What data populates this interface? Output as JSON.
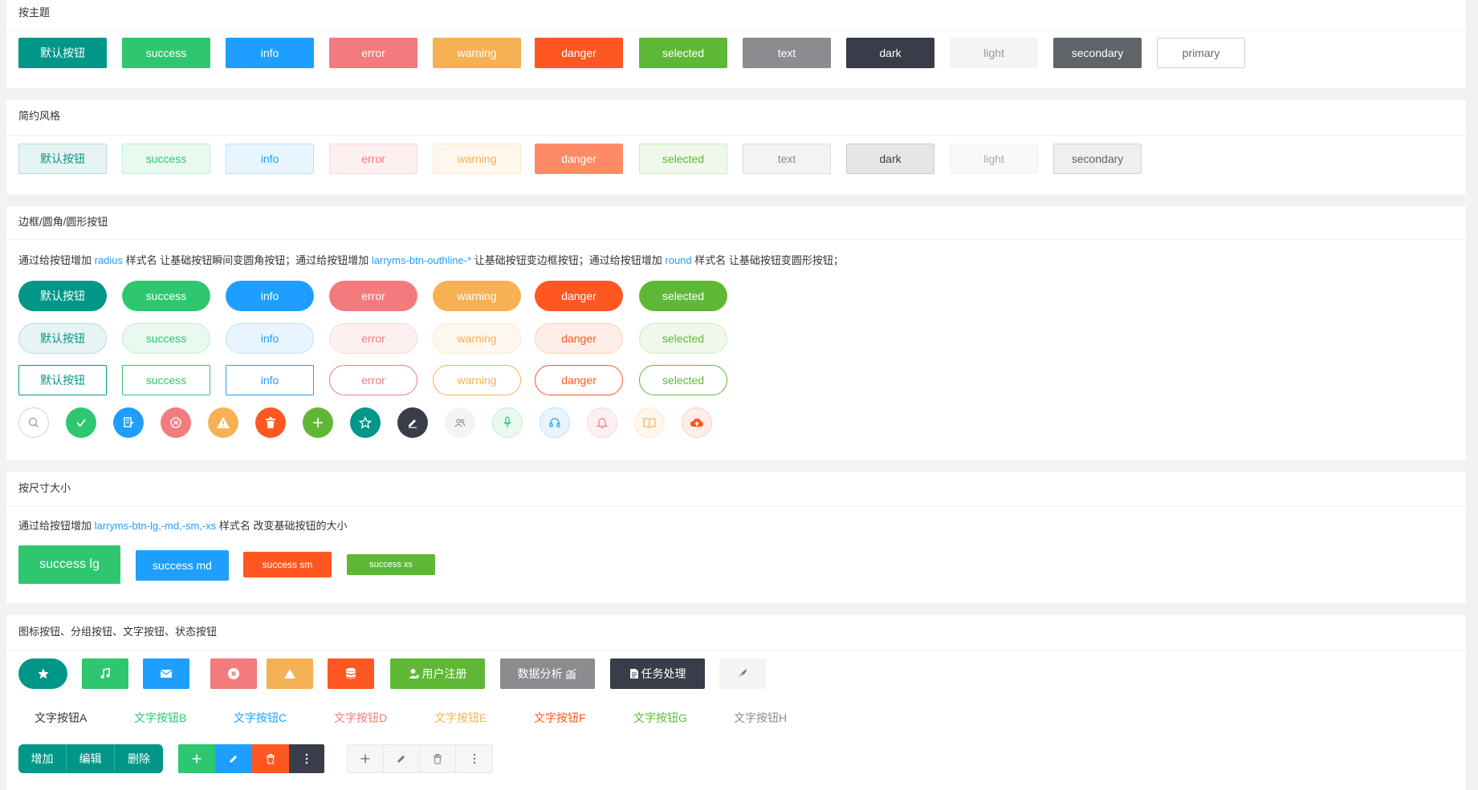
{
  "sections": {
    "theme": {
      "title": "按主题",
      "buttons": [
        "默认按钮",
        "success",
        "info",
        "error",
        "warning",
        "danger",
        "selected",
        "text",
        "dark",
        "light",
        "secondary",
        "primary"
      ]
    },
    "simple": {
      "title": "简约风格",
      "buttons": [
        "默认按钮",
        "success",
        "info",
        "error",
        "warning",
        "danger",
        "selected",
        "text",
        "dark",
        "light",
        "secondary"
      ]
    },
    "border": {
      "title": "边框/圆角/圆形按钮",
      "desc": {
        "p1": "通过给按钮增加 ",
        "k1": "radius",
        "p2": " 样式名 让基础按钮瞬间变圆角按钮；通过给按钮增加 ",
        "k2": "larryms-btn-outhline-*",
        "p3": " 让基础按钮变边框按钮；通过给按钮增加 ",
        "k3": "round",
        "p4": " 样式名 让基础按钮变圆形按钮；"
      },
      "buttons": [
        "默认按钮",
        "success",
        "info",
        "error",
        "warning",
        "danger",
        "selected"
      ]
    },
    "size": {
      "title": "按尺寸大小",
      "desc": {
        "p1": "通过给按钮增加 ",
        "k1": "larryms-btn-lg,-md,-sm,-xs",
        "p2": " 样式名 改变基础按钮的大小"
      },
      "lg": "success lg",
      "md": "success md",
      "sm": "success sm",
      "xs": "success xs"
    },
    "icon": {
      "title": "图标按钮、分组按钮、文字按钮、状态按钮",
      "user_register": "用户注册",
      "data_analysis": "数据分析",
      "task_process": "任务处理",
      "text_buttons": [
        "文字按钮A",
        "文字按钮B",
        "文字按钮C",
        "文字按钮D",
        "文字按钮E",
        "文字按钮F",
        "文字按钮G",
        "文字按钮H"
      ],
      "group": {
        "add": "增加",
        "edit": "编辑",
        "delete": "删除"
      }
    }
  },
  "colors": {
    "default": "#009688",
    "success": "#2ec770",
    "info": "#1e9fff",
    "error": "#f37b7d",
    "warning": "#f7b155",
    "danger": "#ff5722",
    "selected": "#5fb835",
    "text": "#8b8c8f",
    "dark": "#393d49",
    "light": "#f2f4f6",
    "secondary": "#5f6469"
  },
  "icons": [
    "search-icon",
    "check-icon",
    "edit-doc-icon",
    "close-circle-icon",
    "warning-icon",
    "trash-icon",
    "plus-icon",
    "star-icon",
    "pen-icon",
    "users-icon",
    "mic-icon",
    "headset-icon",
    "bell-icon",
    "book-icon",
    "cloud-upload-icon"
  ]
}
